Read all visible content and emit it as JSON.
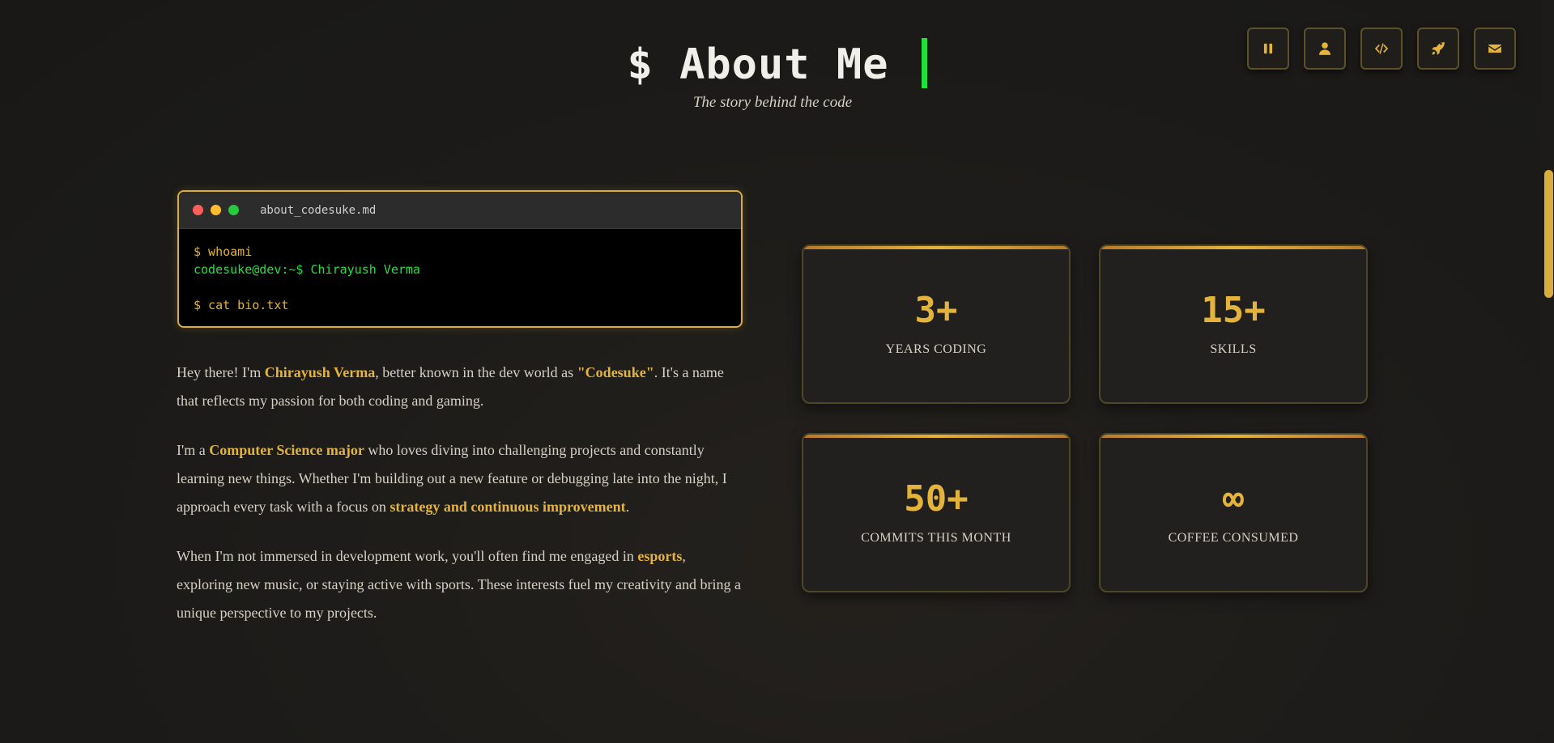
{
  "header": {
    "title": "$ About Me",
    "subtitle": "The story behind the code"
  },
  "nav": [
    {
      "icon": "pause-icon",
      "label": "Pause"
    },
    {
      "icon": "user-icon",
      "label": "About"
    },
    {
      "icon": "code-icon",
      "label": "Skills"
    },
    {
      "icon": "rocket-icon",
      "label": "Projects"
    },
    {
      "icon": "envelope-icon",
      "label": "Contact"
    }
  ],
  "terminal": {
    "filename": "about_codesuke.md",
    "cmd1": "$ whoami",
    "out1": "codesuke@dev:~$ Chirayush Verma",
    "cmd2": "$ cat bio.txt"
  },
  "bio": {
    "p1": {
      "t1": "Hey there! I'm ",
      "h1": "Chirayush Verma",
      "t2": ", better known in the dev world as ",
      "h2": "\"Codesuke\"",
      "t3": ". It's a name that reflects my passion for both coding and gaming."
    },
    "p2": {
      "t1": "I'm a ",
      "h1": "Computer Science major",
      "t2": " who loves diving into challenging projects and constantly learning new things. Whether I'm building out a new feature or debugging late into the night, I approach every task with a focus on ",
      "h2": "strategy and continuous improvement",
      "t3": "."
    },
    "p3": {
      "t1": "When I'm not immersed in development work, you'll often find me engaged in ",
      "h1": "esports",
      "t2": ", exploring new music, or staying active with sports. These interests fuel my creativity and bring a unique perspective to my projects."
    }
  },
  "stats": [
    {
      "value": "3+",
      "label": "YEARS CODING"
    },
    {
      "value": "15+",
      "label": "SKILLS"
    },
    {
      "value": "50+",
      "label": "COMMITS THIS MONTH"
    },
    {
      "value": "∞",
      "label": "COFFEE CONSUMED"
    }
  ],
  "colors": {
    "accent": "#e3b33c",
    "terminal_green": "#22e03a",
    "background": "#1d1c1a"
  }
}
